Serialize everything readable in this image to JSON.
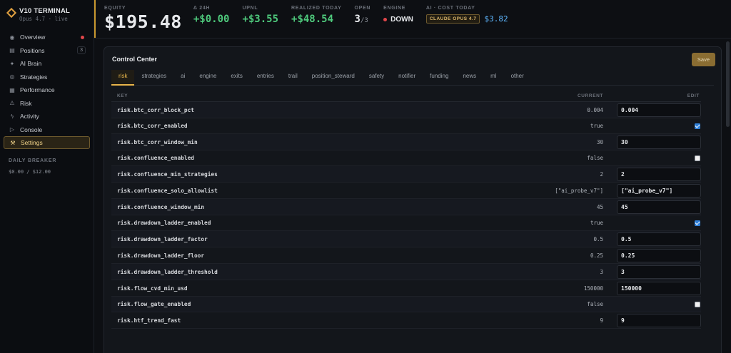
{
  "app": {
    "title": "V10 TERMINAL",
    "subtitle": "Opus 4.7 · live"
  },
  "sidebar": {
    "items": [
      {
        "label": "Overview",
        "icon": "overview-icon",
        "glyph": "◉",
        "dot": true
      },
      {
        "label": "Positions",
        "icon": "positions-icon",
        "glyph": "▤",
        "count": "3"
      },
      {
        "label": "AI Brain",
        "icon": "ai-brain-icon",
        "glyph": "✦"
      },
      {
        "label": "Strategies",
        "icon": "strategies-icon",
        "glyph": "◎"
      },
      {
        "label": "Performance",
        "icon": "performance-icon",
        "glyph": "▦"
      },
      {
        "label": "Risk",
        "icon": "risk-icon",
        "glyph": "⚠"
      },
      {
        "label": "Activity",
        "icon": "activity-icon",
        "glyph": "ϟ"
      },
      {
        "label": "Console",
        "icon": "console-icon",
        "glyph": "▷"
      },
      {
        "label": "Settings",
        "icon": "settings-icon",
        "glyph": "⚒",
        "active": true
      }
    ],
    "breaker_label": "DAILY BREAKER",
    "breaker_value": "$0.00 / $12.00"
  },
  "header": {
    "equity_label": "EQUITY",
    "equity_value": "$195.48",
    "delta_label": "Δ 24H",
    "delta_value": "+$0.00",
    "upnl_label": "UPNL",
    "upnl_value": "+$3.55",
    "realized_label": "REALIZED TODAY",
    "realized_value": "+$48.54",
    "open_label": "OPEN",
    "open_value": "3",
    "open_total": "/3",
    "engine_label": "ENGINE",
    "engine_value": "DOWN",
    "ai_label": "AI · COST TODAY",
    "ai_model": "CLAUDE OPUS 4.7",
    "ai_cost": "$3.82"
  },
  "colors": {
    "accent": "#e8b54a",
    "positive": "#4ec97c",
    "negative": "#e0464a",
    "cost": "#5eb7ff"
  },
  "panel": {
    "title": "Control Center",
    "save_label": "Save",
    "tabs": [
      "risk",
      "strategies",
      "ai",
      "engine",
      "exits",
      "entries",
      "trail",
      "position_steward",
      "safety",
      "notifier",
      "funding",
      "news",
      "ml",
      "other"
    ],
    "active_tab": "risk",
    "columns": {
      "key": "KEY",
      "current": "CURRENT",
      "edit": "EDIT"
    },
    "rows": [
      {
        "key": "risk.btc_corr_block_pct",
        "current": "0.004",
        "type": "input",
        "edit": "0.004"
      },
      {
        "key": "risk.btc_corr_enabled",
        "current": "true",
        "type": "checkbox",
        "edit": true
      },
      {
        "key": "risk.btc_corr_window_min",
        "current": "30",
        "type": "input",
        "edit": "30"
      },
      {
        "key": "risk.confluence_enabled",
        "current": "false",
        "type": "checkbox",
        "edit": false
      },
      {
        "key": "risk.confluence_min_strategies",
        "current": "2",
        "type": "input",
        "edit": "2"
      },
      {
        "key": "risk.confluence_solo_allowlist",
        "current": "[\"ai_probe_v7\"]",
        "type": "input",
        "edit": "[\"ai_probe_v7\"]"
      },
      {
        "key": "risk.confluence_window_min",
        "current": "45",
        "type": "input",
        "edit": "45"
      },
      {
        "key": "risk.drawdown_ladder_enabled",
        "current": "true",
        "type": "checkbox",
        "edit": true
      },
      {
        "key": "risk.drawdown_ladder_factor",
        "current": "0.5",
        "type": "input",
        "edit": "0.5"
      },
      {
        "key": "risk.drawdown_ladder_floor",
        "current": "0.25",
        "type": "input",
        "edit": "0.25"
      },
      {
        "key": "risk.drawdown_ladder_threshold",
        "current": "3",
        "type": "input",
        "edit": "3"
      },
      {
        "key": "risk.flow_cvd_min_usd",
        "current": "150000",
        "type": "input",
        "edit": "150000"
      },
      {
        "key": "risk.flow_gate_enabled",
        "current": "false",
        "type": "checkbox",
        "edit": false
      },
      {
        "key": "risk.htf_trend_fast",
        "current": "9",
        "type": "input",
        "edit": "9"
      }
    ]
  }
}
